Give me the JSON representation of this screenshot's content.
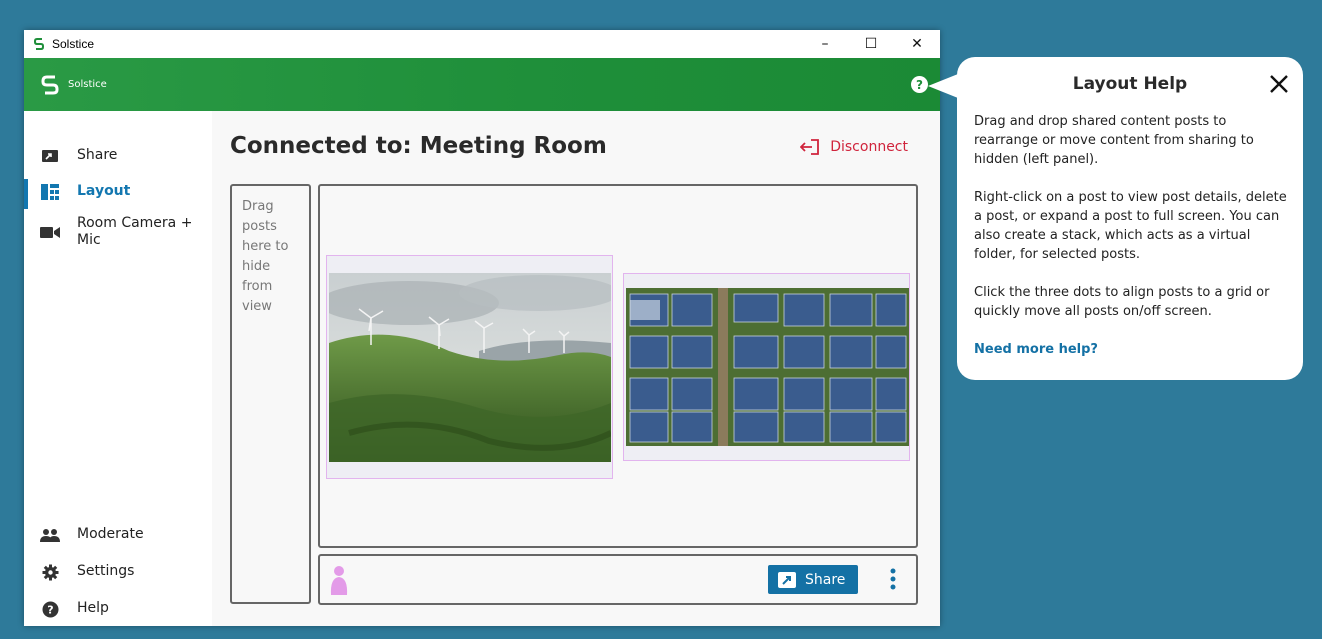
{
  "window": {
    "title": "Solstice",
    "controls": {
      "minimize": "–",
      "maximize": "☐",
      "close": "✕"
    }
  },
  "header": {
    "app_name": "Solstice",
    "help_glyph": "?"
  },
  "sidebar": {
    "items": [
      {
        "label": "Share",
        "icon": "share-screen-icon"
      },
      {
        "label": "Layout",
        "icon": "layout-icon",
        "active": true
      },
      {
        "label": "Room Camera + Mic",
        "icon": "video-camera-icon"
      },
      {
        "label": "Moderate",
        "icon": "people-icon"
      },
      {
        "label": "Settings",
        "icon": "gear-icon"
      },
      {
        "label": "Help",
        "icon": "help-icon"
      }
    ]
  },
  "main": {
    "title": "Connected to: Meeting Room",
    "disconnect_label": "Disconnect",
    "hide_panel_text": "Drag posts here to hide from view",
    "posts": [
      {
        "name": "wind-turbines-post"
      },
      {
        "name": "solar-panels-post"
      }
    ],
    "toolbar": {
      "share_label": "Share"
    }
  },
  "help_popover": {
    "title": "Layout Help",
    "paragraphs": [
      "Drag and drop shared content posts to rearrange or move content from sharing to hidden (left panel).",
      "Right-click on a post to view post details, delete a post, or expand a post to full screen. You can also create a stack, which acts as a virtual folder, for selected posts.",
      "Click the three dots to align posts to a grid or quickly move all posts on/off screen."
    ],
    "link": "Need more help?"
  },
  "colors": {
    "desktop": "#2e7a9a",
    "header_green": "#1f8f3a",
    "accent_blue": "#1377b0",
    "disconnect_red": "#d0243c",
    "avatar_pink": "#e39be8"
  }
}
